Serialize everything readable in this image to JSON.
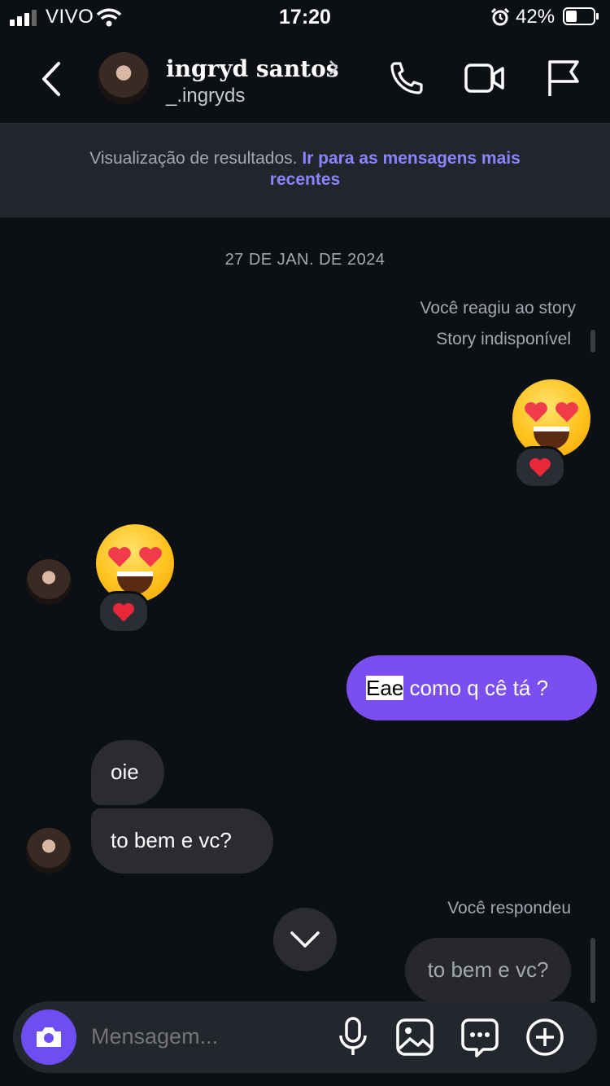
{
  "status_bar": {
    "carrier": "VIVO",
    "time": "17:20",
    "battery_percent": "42%",
    "battery_level": 0.42
  },
  "header": {
    "contact_name": "ingryd santos",
    "username": "_.ingryds",
    "icons": [
      "back-icon",
      "chevron-right-icon",
      "phone-icon",
      "video-icon",
      "flag-icon"
    ]
  },
  "banner": {
    "text": "Visualização de resultados. ",
    "link": "Ir para as mensagens mais recentes"
  },
  "conversation": {
    "date": "27 DE JAN. DE 2024",
    "story_reaction_label": "Você reagiu ao story",
    "story_unavailable": "Story indisponível",
    "messages": [
      {
        "sender": "me",
        "highlight": "Eae",
        "text": " como q cê tá ?"
      },
      {
        "sender": "them",
        "text": "oie"
      },
      {
        "sender": "them",
        "text": "to bem e vc?"
      }
    ],
    "reply_label": "Você respondeu",
    "reply_quote": "to bem e vc?"
  },
  "composer": {
    "placeholder": "Mensagem..."
  },
  "colors": {
    "background": "#0c0f14",
    "accent": "#7b4ef0",
    "link": "#8b84ff",
    "bubble_other": "#2a2c31"
  }
}
